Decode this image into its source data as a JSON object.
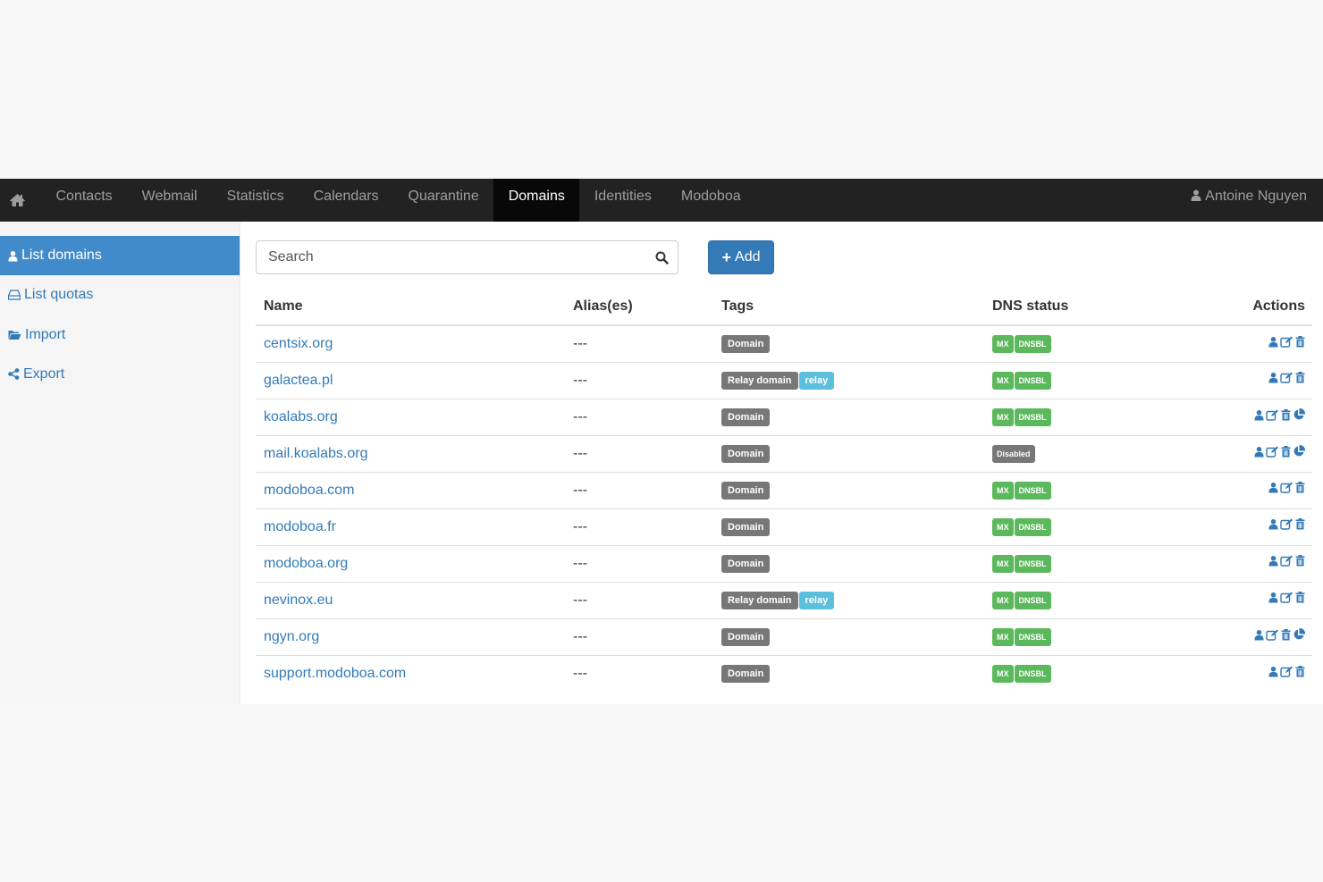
{
  "navbar": {
    "items": [
      {
        "label": "Contacts"
      },
      {
        "label": "Webmail"
      },
      {
        "label": "Statistics"
      },
      {
        "label": "Calendars"
      },
      {
        "label": "Quarantine"
      },
      {
        "label": "Domains",
        "active": true
      },
      {
        "label": "Identities"
      },
      {
        "label": "Modoboa"
      }
    ],
    "user": "Antoine Nguyen"
  },
  "sidebar": {
    "items": [
      {
        "label": "List domains",
        "icon": "user-icon",
        "active": true
      },
      {
        "label": "List quotas",
        "icon": "hdd-icon"
      },
      {
        "label": "Import",
        "icon": "folder-open-icon"
      },
      {
        "label": "Export",
        "icon": "share-icon"
      }
    ]
  },
  "search": {
    "placeholder": "Search"
  },
  "add_button": {
    "label": "Add"
  },
  "table": {
    "headers": {
      "name": "Name",
      "aliases": "Alias(es)",
      "tags": "Tags",
      "dns": "DNS status",
      "actions": "Actions"
    },
    "rows": [
      {
        "name": "centsix.org",
        "aliases": "---",
        "tags": [
          {
            "text": "Domain",
            "type": "default"
          }
        ],
        "dns": [
          "MX",
          "DNSBL"
        ],
        "actions": [
          "user",
          "edit",
          "trash"
        ]
      },
      {
        "name": "galactea.pl",
        "aliases": "---",
        "tags": [
          {
            "text": "Relay domain",
            "type": "default"
          },
          {
            "text": "relay",
            "type": "info"
          }
        ],
        "dns": [
          "MX",
          "DNSBL"
        ],
        "actions": [
          "user",
          "edit",
          "trash"
        ]
      },
      {
        "name": "koalabs.org",
        "aliases": "---",
        "tags": [
          {
            "text": "Domain",
            "type": "default"
          }
        ],
        "dns": [
          "MX",
          "DNSBL"
        ],
        "actions": [
          "user",
          "edit",
          "trash",
          "pie"
        ]
      },
      {
        "name": "mail.koalabs.org",
        "aliases": "---",
        "tags": [
          {
            "text": "Domain",
            "type": "default"
          }
        ],
        "dns": [
          "Disabled"
        ],
        "actions": [
          "user",
          "edit",
          "trash",
          "pie"
        ]
      },
      {
        "name": "modoboa.com",
        "aliases": "---",
        "tags": [
          {
            "text": "Domain",
            "type": "default"
          }
        ],
        "dns": [
          "MX",
          "DNSBL"
        ],
        "actions": [
          "user",
          "edit",
          "trash"
        ]
      },
      {
        "name": "modoboa.fr",
        "aliases": "---",
        "tags": [
          {
            "text": "Domain",
            "type": "default"
          }
        ],
        "dns": [
          "MX",
          "DNSBL"
        ],
        "actions": [
          "user",
          "edit",
          "trash"
        ]
      },
      {
        "name": "modoboa.org",
        "aliases": "---",
        "tags": [
          {
            "text": "Domain",
            "type": "default"
          }
        ],
        "dns": [
          "MX",
          "DNSBL"
        ],
        "actions": [
          "user",
          "edit",
          "trash"
        ]
      },
      {
        "name": "nevinox.eu",
        "aliases": "---",
        "tags": [
          {
            "text": "Relay domain",
            "type": "default"
          },
          {
            "text": "relay",
            "type": "info"
          }
        ],
        "dns": [
          "MX",
          "DNSBL"
        ],
        "actions": [
          "user",
          "edit",
          "trash"
        ]
      },
      {
        "name": "ngyn.org",
        "aliases": "---",
        "tags": [
          {
            "text": "Domain",
            "type": "default"
          }
        ],
        "dns": [
          "MX",
          "DNSBL"
        ],
        "actions": [
          "user",
          "edit",
          "trash",
          "pie"
        ]
      },
      {
        "name": "support.modoboa.com",
        "aliases": "---",
        "tags": [
          {
            "text": "Domain",
            "type": "default"
          }
        ],
        "dns": [
          "MX",
          "DNSBL"
        ],
        "actions": [
          "user",
          "edit",
          "trash"
        ]
      }
    ]
  },
  "colors": {
    "navbar": "#222222",
    "link": "#337ab7",
    "primary": "#428bca",
    "success": "#5cb85c",
    "info": "#5bc0de",
    "label_default": "#777777"
  }
}
